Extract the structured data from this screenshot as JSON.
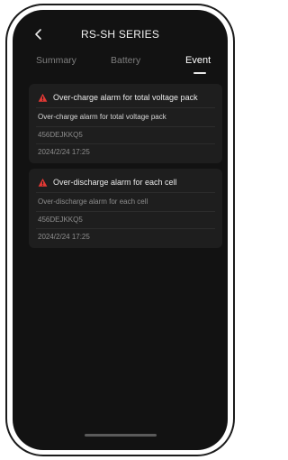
{
  "header": {
    "title": "RS-SH SERIES",
    "back_icon": "chevron-left-icon"
  },
  "tabs": [
    {
      "label": "Summary",
      "active": false
    },
    {
      "label": "Battery",
      "active": false
    },
    {
      "label": "Event",
      "active": true
    }
  ],
  "events": [
    {
      "title": "Over-charge alarm for total voltage pack",
      "description": "Over-charge alarm for total voltage pack",
      "device_id": "456DEJKKQ5",
      "timestamp": "2024/2/24 17:25",
      "icon": "warning-triangle-icon"
    },
    {
      "title": "Over-discharge alarm for each cell",
      "description": "Over-discharge alarm for each cell",
      "device_id": "456DEJKKQ5",
      "timestamp": "2024/2/24 17:25",
      "icon": "warning-triangle-icon"
    }
  ],
  "colors": {
    "background": "#121212",
    "card": "#1e1e1e",
    "alert": "#e53935",
    "active_tab": "#ffffff",
    "inactive_tab": "#7f7f7f"
  }
}
